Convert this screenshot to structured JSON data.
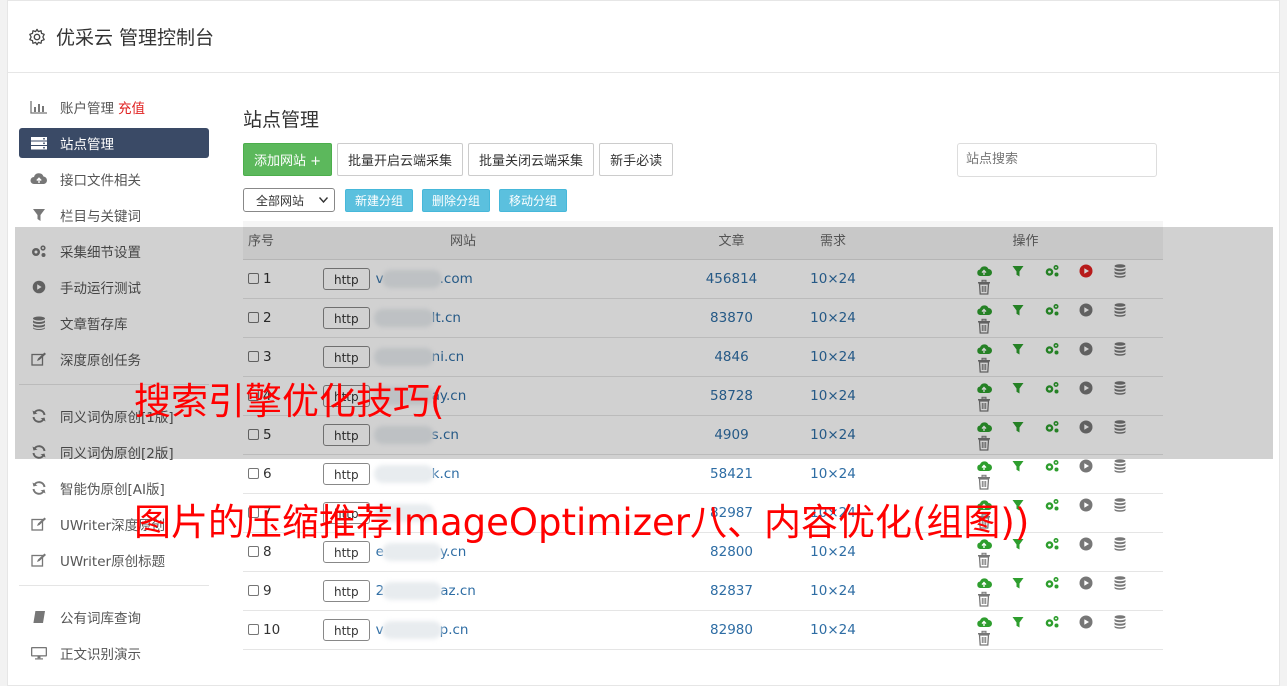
{
  "header": {
    "title": "优采云 管理控制台"
  },
  "sidebar": {
    "groups": [
      [
        {
          "label": "账户管理",
          "extra": "充值",
          "icon": "bar-chart-icon"
        },
        {
          "label": "站点管理",
          "icon": "server-icon",
          "active": true
        },
        {
          "label": "接口文件相关",
          "icon": "cloud-upload-icon"
        },
        {
          "label": "栏目与关键词",
          "icon": "filter-icon"
        },
        {
          "label": "采集细节设置",
          "icon": "cogs-icon"
        },
        {
          "label": "手动运行测试",
          "icon": "play-circle-icon"
        },
        {
          "label": "文章暂存库",
          "icon": "database-icon"
        },
        {
          "label": "深度原创任务",
          "icon": "edit-icon"
        }
      ],
      [
        {
          "label": "同义词伪原创[1版]",
          "icon": "refresh-icon"
        },
        {
          "label": "同义词伪原创[2版]",
          "icon": "refresh-icon"
        },
        {
          "label": "智能伪原创[AI版]",
          "icon": "refresh-icon"
        },
        {
          "label": "UWriter深度原创",
          "icon": "edit-icon"
        },
        {
          "label": "UWriter原创标题",
          "icon": "edit-icon"
        }
      ],
      [
        {
          "label": "公有词库查询",
          "icon": "book-icon"
        },
        {
          "label": "正文识别演示",
          "icon": "monitor-icon"
        }
      ]
    ]
  },
  "main": {
    "title": "站点管理",
    "toolbar": {
      "add_label": "添加网站 +",
      "batch_open_label": "批量开启云端采集",
      "batch_close_label": "批量关闭云端采集",
      "newbie_label": "新手必读",
      "search_placeholder": "站点搜索"
    },
    "subbar": {
      "group_select": "全部网站",
      "new_group": "新建分组",
      "delete_group": "删除分组",
      "move_group": "移动分组"
    },
    "table": {
      "headers": {
        "no": "序号",
        "site": "网站",
        "articles": "文章",
        "demand": "需求",
        "ops": "操作"
      },
      "rows": [
        {
          "no": "1",
          "proto": "http",
          "site_prefix": "v",
          "site_suffix": ".com",
          "articles": "456814",
          "demand": "10×24",
          "play_color": "#e02020"
        },
        {
          "no": "2",
          "proto": "http",
          "site_prefix": "",
          "site_suffix": "lt.cn",
          "articles": "83870",
          "demand": "10×24"
        },
        {
          "no": "3",
          "proto": "http",
          "site_prefix": "",
          "site_suffix": "ni.cn",
          "articles": "4846",
          "demand": "10×24"
        },
        {
          "no": "4",
          "proto": "http",
          "site_prefix": "",
          "site_suffix": "ay.cn",
          "articles": "58728",
          "demand": "10×24"
        },
        {
          "no": "5",
          "proto": "http",
          "site_prefix": "",
          "site_suffix": "s.cn",
          "articles": "4909",
          "demand": "10×24"
        },
        {
          "no": "6",
          "proto": "http",
          "site_prefix": "",
          "site_suffix": "k.cn",
          "articles": "58421",
          "demand": "10×24"
        },
        {
          "no": "7",
          "proto": "http",
          "site_prefix": "",
          "site_suffix": "",
          "articles": "82987",
          "demand": "10×24"
        },
        {
          "no": "8",
          "proto": "http",
          "site_prefix": "e",
          "site_suffix": "y.cn",
          "articles": "82800",
          "demand": "10×24"
        },
        {
          "no": "9",
          "proto": "http",
          "site_prefix": "2",
          "site_suffix": "az.cn",
          "articles": "82837",
          "demand": "10×24"
        },
        {
          "no": "10",
          "proto": "http",
          "site_prefix": "v",
          "site_suffix": "p.cn",
          "articles": "82980",
          "demand": "10×24"
        }
      ]
    }
  },
  "watermark": {
    "line1": "搜索引擎优化技巧(",
    "line2": "图片的压缩推荐ImageOptimizer八、内容优化(组图))"
  },
  "colors": {
    "accent_green": "#2e9e2e",
    "sidebar_active": "#3a4a66",
    "link_blue": "#2e6da4"
  }
}
